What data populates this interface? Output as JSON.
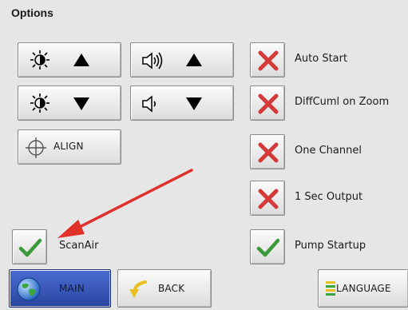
{
  "title": "Options",
  "controls": {
    "align_label": "ALIGN"
  },
  "toggles": [
    {
      "label": "Auto Start",
      "checked": false
    },
    {
      "label": "DiffCuml on Zoom",
      "checked": false
    },
    {
      "label": "One Channel",
      "checked": false
    },
    {
      "label": "1 Sec Output",
      "checked": false
    },
    {
      "label": "Pump Startup",
      "checked": true
    },
    {
      "label": "ScanAir",
      "checked": true
    }
  ],
  "nav": {
    "main_label": "MAIN",
    "back_label": "BACK",
    "language_label": "LANGUAGE"
  },
  "colors": {
    "x_mark": "#d43a3a",
    "check_mark": "#3c9a3c",
    "main_button_bg": "#2f4fb0",
    "arrow": "#e0302a"
  }
}
